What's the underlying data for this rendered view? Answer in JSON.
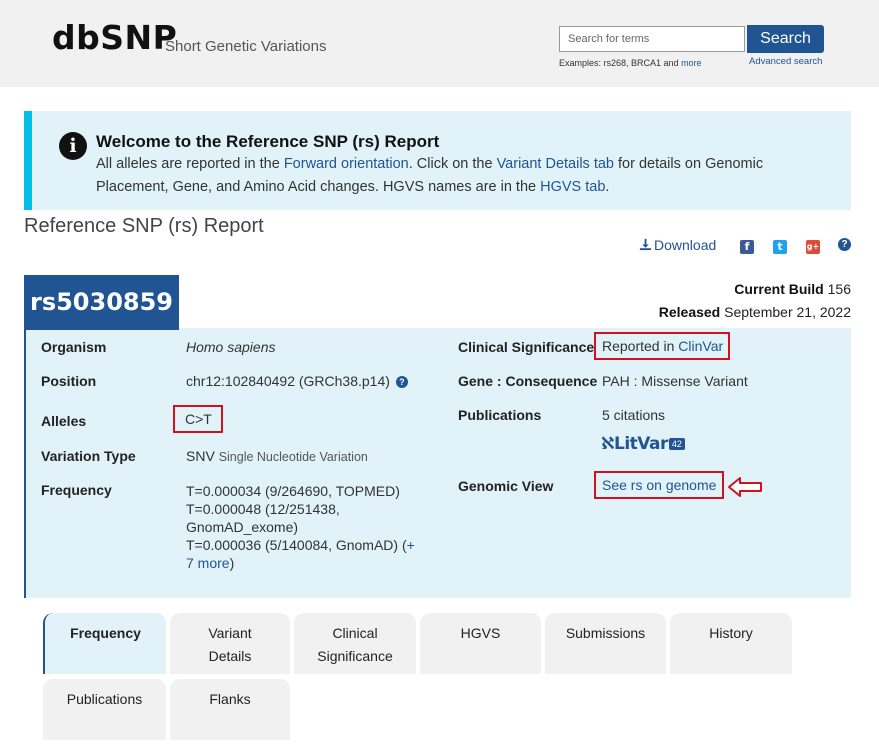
{
  "header": {
    "logo": "dbSNP",
    "tagline": "Short Genetic Variations",
    "search_placeholder": "Search for terms",
    "search_button": "Search",
    "examples_prefix": "Examples: rs268, BRCA1 and ",
    "examples_more": "more",
    "advanced_search": "Advanced search"
  },
  "banner": {
    "title": "Welcome to the Reference SNP (rs) Report",
    "t1": "All alleles are reported in the ",
    "l1": "Forward orientation",
    "t2": ". Click on the ",
    "l2": "Variant Details tab",
    "t3": " for details on Genomic Placement, Gene, and Amino Acid changes. HGVS names are in the ",
    "l3": "HGVS tab",
    "t4": "."
  },
  "report_title": "Reference SNP (rs) Report",
  "share": {
    "download": "Download",
    "facebook_icon": "f",
    "twitter_icon": "t",
    "googleplus_icon": "g+",
    "help_icon": "?"
  },
  "build": {
    "current_label": "Current Build",
    "current_value": "156",
    "released_label": "Released",
    "released_value": "September 21, 2022"
  },
  "rsid": "rs5030859",
  "fields": {
    "organism_label": "Organism",
    "organism_value": "Homo sapiens",
    "position_label": "Position",
    "position_value": "chr12:102840492 (GRCh38.p14)",
    "alleles_label": "Alleles",
    "alleles_value": "C>T",
    "variation_type_label": "Variation Type",
    "variation_type_value": "SNV",
    "variation_type_desc": "Single Nucleotide Variation",
    "frequency_label": "Frequency",
    "frequency_lines": [
      "T=0.000034 (9/264690, TOPMED)",
      "T=0.000048 (12/251438, GnomAD_exome)",
      "T=0.000036 (5/140084, GnomAD)"
    ],
    "frequency_more": "+ 7 more",
    "clinical_label": "Clinical Significance",
    "clinical_prefix": "Reported in ",
    "clinical_link": "ClinVar",
    "gene_label": "Gene : Consequence",
    "gene_value": "PAH : Missense Variant",
    "publications_label": "Publications",
    "publications_value": "5 citations",
    "litvar_text": "LitVar",
    "litvar_count": "42",
    "genomic_label": "Genomic View",
    "genomic_link": "See rs on genome"
  },
  "tabs": [
    {
      "label": "Frequency",
      "active": true
    },
    {
      "label": "Variant Details"
    },
    {
      "label": "Clinical Significance"
    },
    {
      "label": "HGVS"
    },
    {
      "label": "Submissions"
    },
    {
      "label": "History"
    },
    {
      "label": "Publications"
    },
    {
      "label": "Flanks"
    }
  ],
  "colors": {
    "primary_blue": "#205493",
    "banner_bg": "#e1f3f8",
    "banner_accent": "#02bfe7",
    "highlight_red": "#d0121e"
  }
}
